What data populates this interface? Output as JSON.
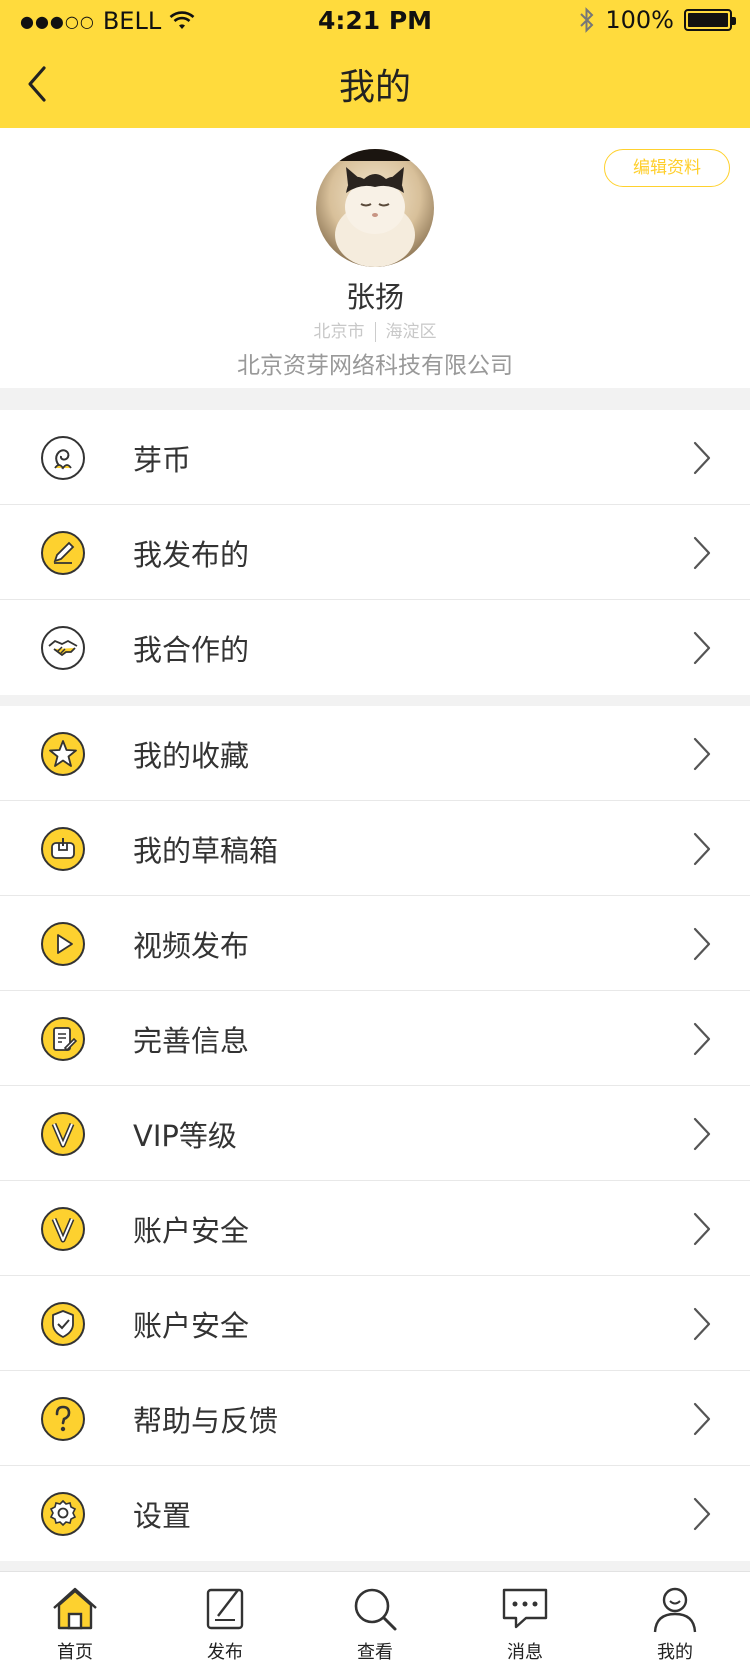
{
  "status_bar": {
    "carrier": "BELL",
    "time": "4:21 PM",
    "battery": "100%"
  },
  "nav": {
    "title": "我的"
  },
  "profile": {
    "edit_label": "编辑资料",
    "name": "张扬",
    "city": "北京市",
    "district": "海淀区",
    "company": "北京资芽网络科技有限公司"
  },
  "menu_group_1": [
    {
      "label": "芽币",
      "icon": "sprout-coin-icon"
    },
    {
      "label": "我发布的",
      "icon": "pencil-icon"
    },
    {
      "label": "我合作的",
      "icon": "handshake-icon"
    }
  ],
  "menu_group_2": [
    {
      "label": "我的收藏",
      "icon": "star-icon"
    },
    {
      "label": "我的草稿箱",
      "icon": "drafts-box-icon"
    },
    {
      "label": "视频发布",
      "icon": "play-icon"
    },
    {
      "label": "完善信息",
      "icon": "edit-document-icon"
    },
    {
      "label": "VIP等级",
      "icon": "vip-icon"
    },
    {
      "label": "账户安全",
      "icon": "vip-icon"
    },
    {
      "label": "账户安全",
      "icon": "shield-check-icon"
    },
    {
      "label": "帮助与反馈",
      "icon": "help-icon"
    },
    {
      "label": "设置",
      "icon": "gear-icon"
    }
  ],
  "tabs": [
    {
      "label": "首页",
      "icon": "home-icon",
      "active": true
    },
    {
      "label": "发布",
      "icon": "publish-icon"
    },
    {
      "label": "查看",
      "icon": "search-icon"
    },
    {
      "label": "消息",
      "icon": "message-icon"
    },
    {
      "label": "我的",
      "icon": "user-icon"
    }
  ],
  "colors": {
    "accent": "#ffdb3d",
    "icon_fill": "#fdd12f"
  }
}
